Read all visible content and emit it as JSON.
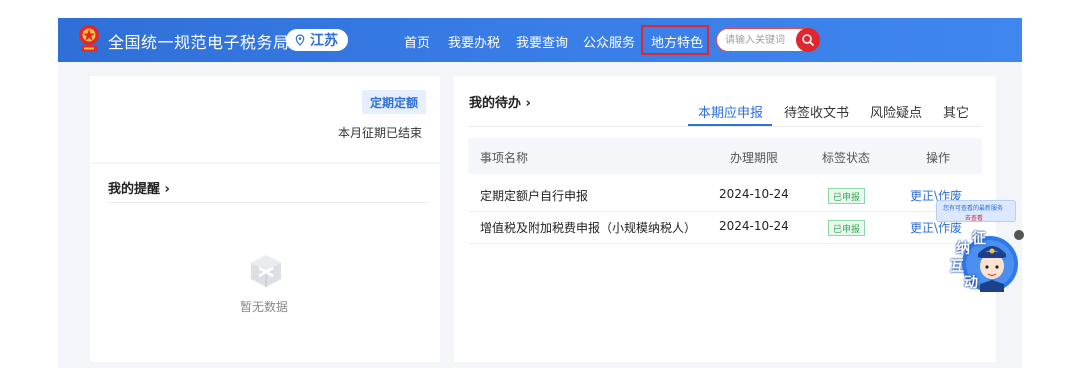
{
  "header": {
    "site_title": "全国统一规范电子税务局",
    "region": "江苏",
    "nav": [
      "首页",
      "我要办税",
      "我要查询",
      "公众服务",
      "地方特色"
    ],
    "search_placeholder": "请输入关键词"
  },
  "period_card": {
    "tag": "定期定额",
    "status": "本月征期已结束"
  },
  "reminder_card": {
    "title": "我的提醒",
    "arrow": "›",
    "empty_text": "暂无数据"
  },
  "todo_card": {
    "title": "我的待办",
    "arrow": "›",
    "tabs": [
      "本期应申报",
      "待签收文书",
      "风险疑点",
      "其它"
    ],
    "columns": [
      "事项名称",
      "办理期限",
      "标签状态",
      "操作"
    ],
    "rows": [
      {
        "name": "定期定额户自行申报",
        "deadline": "2024-10-24",
        "status": "已申报",
        "action": "更正\\作废"
      },
      {
        "name": "增值税及附加税费申报（小规模纳税人）",
        "deadline": "2024-10-24",
        "status": "已申报",
        "action": "更正\\作废"
      }
    ]
  },
  "assistant": {
    "tip": "您有可查看的最新服务",
    "tip_link": "去查看",
    "glyphs": [
      "征",
      "纳",
      "互",
      "动"
    ]
  },
  "colors": {
    "brand_blue": "#2f6fd8",
    "highlight_red": "#e0262e",
    "status_green": "#2eaa55"
  }
}
